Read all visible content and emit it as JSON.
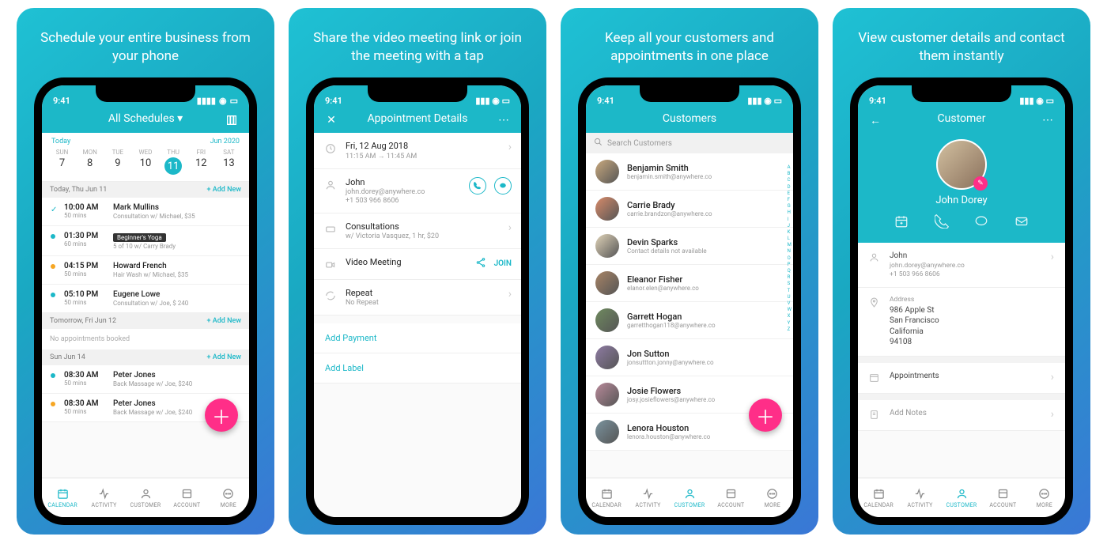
{
  "panels": [
    {
      "caption": "Schedule your entire business from your phone"
    },
    {
      "caption": "Share the video meeting link or join the meeting with a tap"
    },
    {
      "caption": "Keep all your customers and appointments in one place"
    },
    {
      "caption": "View customer details and contact them instantly"
    }
  ],
  "status_time": "9:41",
  "p1": {
    "header_title": "All Schedules ▾",
    "today_label": "Today",
    "month_label": "Jun 2020",
    "days": [
      {
        "dow": "SUN",
        "num": "7"
      },
      {
        "dow": "MON",
        "num": "8"
      },
      {
        "dow": "TUE",
        "num": "9"
      },
      {
        "dow": "WED",
        "num": "10"
      },
      {
        "dow": "THU",
        "num": "11",
        "selected": true
      },
      {
        "dow": "FRI",
        "num": "12"
      },
      {
        "dow": "SAT",
        "num": "13"
      }
    ],
    "sections": [
      {
        "label": "Today, Thu Jun 11",
        "add": "+  Add New",
        "rows": [
          {
            "status": "check",
            "time": "10:00 AM",
            "dur": "50 mins",
            "title": "Mark Mullins",
            "sub": "Consultation w/ Michael, $35"
          },
          {
            "status": "dot",
            "time": "01:30 PM",
            "dur": "60 mins",
            "badge": "Beginner's Yoga",
            "sub": "5 of 10 w/ Carry Brady"
          },
          {
            "status": "dot-orange",
            "time": "04:15 PM",
            "dur": "50 mins",
            "title": "Howard French",
            "sub": "Hair Wash w/ Michael, $35"
          },
          {
            "status": "dot",
            "time": "05:10 PM",
            "dur": "50 mins",
            "title": "Eugene Lowe",
            "sub": "Consultation w/ Joe,  $ 240"
          }
        ]
      },
      {
        "label": "Tomorrow, Fri Jun 12",
        "add": "+  Add New",
        "empty": "No appointments booked"
      },
      {
        "label": "Sun Jun 14",
        "add": "+  Add New",
        "rows": [
          {
            "status": "dot",
            "time": "08:30 AM",
            "dur": "50 mins",
            "title": "Peter Jones",
            "sub": "Back Massage w/ Joe,  $240"
          },
          {
            "status": "dot-orange",
            "time": "08:30 AM",
            "dur": "50 mins",
            "title": "Peter Jones",
            "sub": "Back Massage w/ Joe,  $240"
          }
        ]
      }
    ]
  },
  "p2": {
    "header_title": "Appointment Details",
    "rows": {
      "date_l1": "Fri, 12 Aug 2018",
      "date_l2": "11:15 AM  →  11:45 AM",
      "cust_name": "John",
      "cust_email": "john.dorey@anywhere.co",
      "cust_phone": "+1 503 966 8606",
      "service_l1": "Consultations",
      "service_l2": "w/ Victoria Vasquez, 1 hr, $20",
      "video_label": "Video Meeting",
      "join_label": "JOIN",
      "repeat_l1": "Repeat",
      "repeat_l2": "No Repeat"
    },
    "link_add_payment": "Add Payment",
    "link_add_label": "Add Label"
  },
  "p3": {
    "header_title": "Customers",
    "search_ph": "Search Customers",
    "customers": [
      {
        "name": "Benjamin Smith",
        "email": "benjamin.smith@anywhere.co"
      },
      {
        "name": "Carrie Brady",
        "email": "carrie.brandzon@anywhere.co"
      },
      {
        "name": "Devin Sparks",
        "email": "Contact details not available"
      },
      {
        "name": "Eleanor Fisher",
        "email": "elanor.elen@anywhere.co"
      },
      {
        "name": "Garrett Hogan",
        "email": "garretthogan118@anywhere.co"
      },
      {
        "name": "Jon Sutton",
        "email": "jonsuttton.jonny@anywhere.co"
      },
      {
        "name": "Josie Flowers",
        "email": "josy.josieflowers@anywhere.co"
      },
      {
        "name": "Lenora Houston",
        "email": "lenora.houston@anywhere.co"
      }
    ],
    "az": [
      "A",
      "B",
      "C",
      "D",
      "E",
      "F",
      "G",
      "H",
      "I",
      "J",
      "K",
      "L",
      "M",
      "N",
      "O",
      "P",
      "Q",
      "R",
      "S",
      "T",
      "U",
      "V",
      "W",
      "X",
      "Y",
      "Z"
    ]
  },
  "p4": {
    "header_title": "Customer",
    "hero_name": "John Dorey",
    "contact_name": "John",
    "contact_email": "john.dorey@anywhere.co",
    "contact_phone": "+1 503 966 8606",
    "address_label": "Address",
    "address_lines": [
      "986 Apple St",
      "San Francisco",
      "California",
      "94108"
    ],
    "appointments_label": "Appointments",
    "notes_label": "Add Notes"
  },
  "tabs": {
    "calendar": "CALENDAR",
    "activity": "ACTIVITY",
    "customer": "CUSTOMER",
    "account": "ACCOUNT",
    "more": "MORE"
  }
}
